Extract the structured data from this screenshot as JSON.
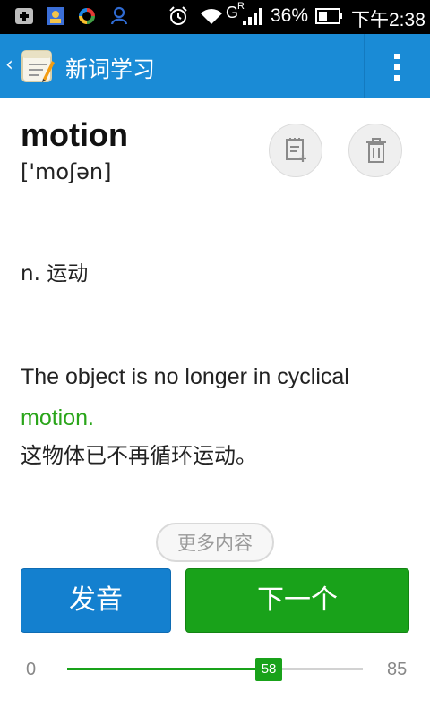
{
  "status_bar": {
    "battery_percent": "36%",
    "time": "下午2:38",
    "network_label": "G",
    "roaming_mark": "R"
  },
  "action_bar": {
    "back_glyph": "‹",
    "title": "新词学习",
    "colors": {
      "bar": "#1a8bd6"
    }
  },
  "word": {
    "headword": "motion",
    "phonetic": "['moʃən]"
  },
  "definition": "n. 运动",
  "example": {
    "before": "The object is no longer in cyclical ",
    "highlight": "motion",
    "after": ".",
    "translation": "这物体已不再循环运动。"
  },
  "more_button": "更多内容",
  "buttons": {
    "pronounce": "发音",
    "next": "下一个"
  },
  "progress": {
    "min": "0",
    "max": "85",
    "current": "58",
    "fraction": 0.682
  },
  "icons": {
    "add_note": "add-to-notebook-icon",
    "delete": "trash-icon"
  }
}
